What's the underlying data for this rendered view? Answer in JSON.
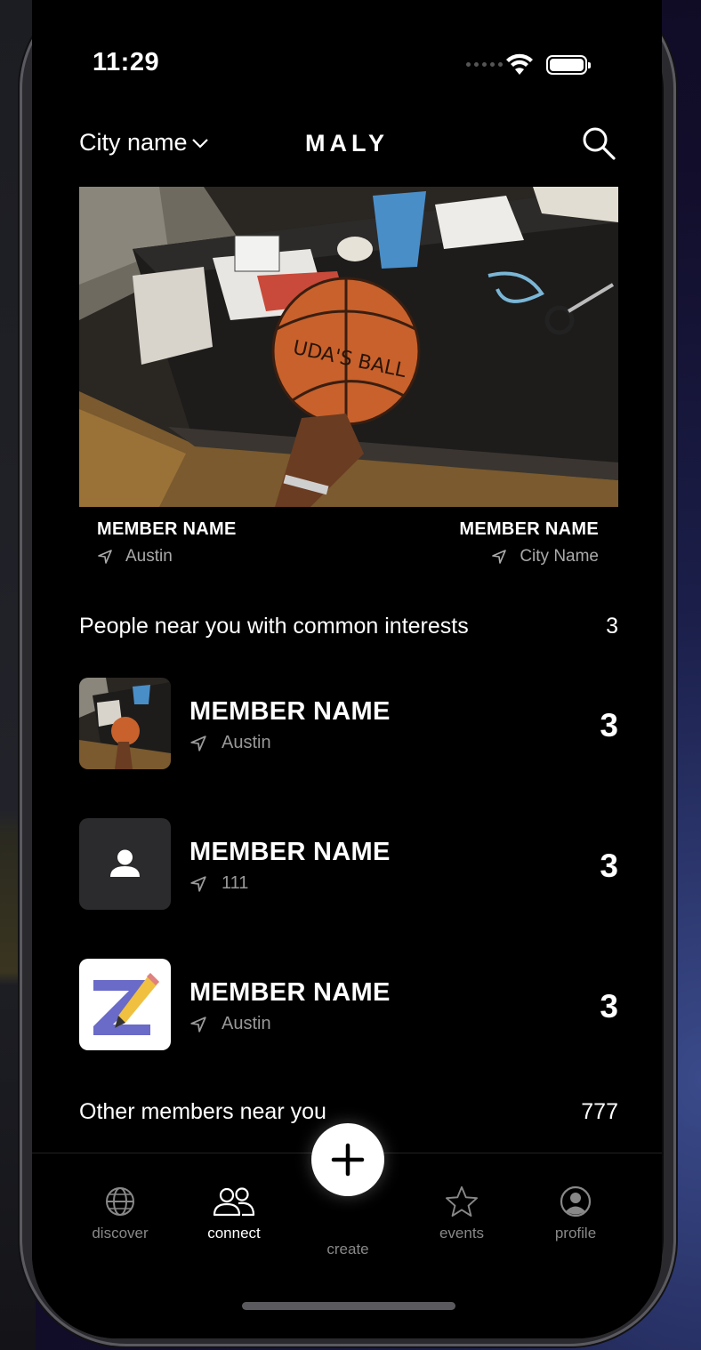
{
  "status_bar": {
    "time": "11:29"
  },
  "header": {
    "city_label": "City name",
    "title": "MALY"
  },
  "featured": {
    "left": {
      "name": "MEMBER NAME",
      "location": "Austin"
    },
    "right": {
      "name": "MEMBER NAME",
      "location": "City Name"
    }
  },
  "common_interests": {
    "title": "People near you with common interests",
    "count": "3",
    "members": [
      {
        "name": "MEMBER NAME",
        "location": "Austin",
        "count": "3",
        "avatar": "photo-basketball"
      },
      {
        "name": "MEMBER NAME",
        "location": "111",
        "count": "3",
        "avatar": "person-placeholder-icon"
      },
      {
        "name": "MEMBER NAME",
        "location": "Austin",
        "count": "3",
        "avatar": "z-pencil-logo"
      }
    ]
  },
  "other_members": {
    "title": "Other members near you",
    "count": "777"
  },
  "tabbar": {
    "discover": "discover",
    "connect": "connect",
    "create": "create",
    "events": "events",
    "profile": "profile",
    "active": "connect"
  },
  "colors": {
    "background": "#000000",
    "text": "#ffffff",
    "muted": "#999999"
  }
}
